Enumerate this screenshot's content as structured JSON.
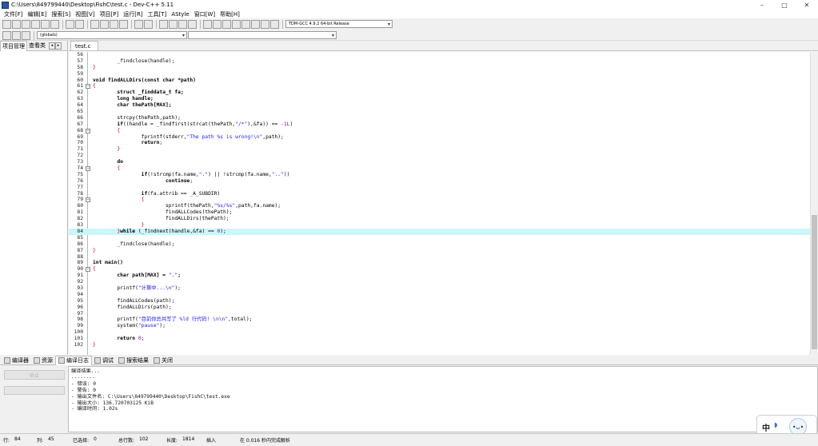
{
  "window": {
    "title": "C:\\Users\\849799440\\Desktop\\FishC\\test.c - Dev-C++ 5.11"
  },
  "menu": [
    {
      "label": "文件[F]"
    },
    {
      "label": "编辑[E]"
    },
    {
      "label": "搜索[S]"
    },
    {
      "label": "视图[V]"
    },
    {
      "label": "项目[P]"
    },
    {
      "label": "运行[R]"
    },
    {
      "label": "工具[T]"
    },
    {
      "label": "AStyle"
    },
    {
      "label": "窗口[W]"
    },
    {
      "label": "帮助[H]"
    }
  ],
  "toolbar": {
    "compiler_select": "TDM-GCC 4.9.2 64-bit Release",
    "scope_select": "(globals)",
    "symbol_select": ""
  },
  "left_panel": {
    "tabs": [
      {
        "label": "项目管理"
      },
      {
        "label": "查看类"
      }
    ]
  },
  "editor": {
    "tab_label": "test.c",
    "lines": [
      {
        "n": "56",
        "fold": "",
        "code": [
          {
            "t": ""
          }
        ]
      },
      {
        "n": "57",
        "fold": "",
        "code": [
          {
            "t": "        _findclose(handle);"
          }
        ]
      },
      {
        "n": "58",
        "fold": "",
        "code": [
          {
            "t": "}",
            "c": "sym"
          }
        ]
      },
      {
        "n": "59",
        "fold": "",
        "code": [
          {
            "t": ""
          }
        ]
      },
      {
        "n": "60",
        "fold": "",
        "code": [
          {
            "t": "void",
            "c": "kw"
          },
          {
            "t": " findALLDirs(",
            "c": "kw"
          },
          {
            "t": "const",
            "c": "kw"
          },
          {
            "t": " char",
            "c": "kw"
          },
          {
            "t": " *path)",
            "c": "kw"
          }
        ]
      },
      {
        "n": "61",
        "fold": "−",
        "code": [
          {
            "t": "{",
            "c": "sym"
          }
        ]
      },
      {
        "n": "62",
        "fold": "",
        "code": [
          {
            "t": "        "
          },
          {
            "t": "struct",
            "c": "kw"
          },
          {
            "t": " _finddata_t fa;",
            "c": "kw"
          }
        ]
      },
      {
        "n": "63",
        "fold": "",
        "code": [
          {
            "t": "        "
          },
          {
            "t": "long",
            "c": "kw"
          },
          {
            "t": " handle;",
            "c": "kw"
          }
        ]
      },
      {
        "n": "64",
        "fold": "",
        "code": [
          {
            "t": "        "
          },
          {
            "t": "char",
            "c": "kw"
          },
          {
            "t": " thePath[MAX];",
            "c": "kw"
          }
        ]
      },
      {
        "n": "65",
        "fold": "",
        "code": [
          {
            "t": ""
          }
        ]
      },
      {
        "n": "66",
        "fold": "",
        "code": [
          {
            "t": "        strcpy(thePath,path);"
          }
        ]
      },
      {
        "n": "67",
        "fold": "",
        "code": [
          {
            "t": "        "
          },
          {
            "t": "if",
            "c": "kw"
          },
          {
            "t": "((handle = _findfirst(strcat(thePath,"
          },
          {
            "t": "\"/*\"",
            "c": "str"
          },
          {
            "t": "),&fa)) == "
          },
          {
            "t": "-1L",
            "c": "num"
          },
          {
            "t": ")"
          }
        ]
      },
      {
        "n": "68",
        "fold": "−",
        "code": [
          {
            "t": "        "
          },
          {
            "t": "{",
            "c": "sym"
          }
        ]
      },
      {
        "n": "69",
        "fold": "",
        "code": [
          {
            "t": "                fprintf(stderr,"
          },
          {
            "t": "\"The path %s is wrong!\\n\"",
            "c": "str"
          },
          {
            "t": ",path);"
          }
        ]
      },
      {
        "n": "70",
        "fold": "",
        "code": [
          {
            "t": "                "
          },
          {
            "t": "return",
            "c": "kw"
          },
          {
            "t": ";"
          }
        ]
      },
      {
        "n": "71",
        "fold": "",
        "code": [
          {
            "t": "        "
          },
          {
            "t": "}",
            "c": "sym"
          }
        ]
      },
      {
        "n": "72",
        "fold": "",
        "code": [
          {
            "t": ""
          }
        ]
      },
      {
        "n": "73",
        "fold": "",
        "code": [
          {
            "t": "        "
          },
          {
            "t": "do",
            "c": "kw"
          }
        ]
      },
      {
        "n": "74",
        "fold": "−",
        "code": [
          {
            "t": "        "
          },
          {
            "t": "{",
            "c": "sym"
          }
        ]
      },
      {
        "n": "75",
        "fold": "",
        "code": [
          {
            "t": "                "
          },
          {
            "t": "if",
            "c": "kw"
          },
          {
            "t": "(!strcmp(fa.name,"
          },
          {
            "t": "\".\"",
            "c": "str"
          },
          {
            "t": ") || !strcmp(fa.name,"
          },
          {
            "t": "\"..\"",
            "c": "str"
          },
          {
            "t": "))"
          }
        ]
      },
      {
        "n": "76",
        "fold": "",
        "code": [
          {
            "t": "                        "
          },
          {
            "t": "continue",
            "c": "kw"
          },
          {
            "t": ";"
          }
        ]
      },
      {
        "n": "77",
        "fold": "",
        "code": [
          {
            "t": ""
          }
        ]
      },
      {
        "n": "78",
        "fold": "",
        "code": [
          {
            "t": "                "
          },
          {
            "t": "if",
            "c": "kw"
          },
          {
            "t": "(fa.attrib == _A_SUBDIR)"
          }
        ]
      },
      {
        "n": "79",
        "fold": "−",
        "code": [
          {
            "t": "                "
          },
          {
            "t": "{",
            "c": "sym"
          }
        ]
      },
      {
        "n": "80",
        "fold": "",
        "code": [
          {
            "t": "                        sprintf(thePath,"
          },
          {
            "t": "\"%s/%s\"",
            "c": "str"
          },
          {
            "t": ",path,fa.name);"
          }
        ]
      },
      {
        "n": "81",
        "fold": "",
        "code": [
          {
            "t": "                        findALLCodes(thePath);"
          }
        ]
      },
      {
        "n": "82",
        "fold": "",
        "code": [
          {
            "t": "                        findALLDirs(thePath);"
          }
        ]
      },
      {
        "n": "83",
        "fold": "",
        "code": [
          {
            "t": "                "
          },
          {
            "t": "}",
            "c": "sym"
          }
        ]
      },
      {
        "n": "84",
        "fold": "",
        "hl": true,
        "code": [
          {
            "t": "        "
          },
          {
            "t": "}",
            "c": "sym"
          },
          {
            "t": "while",
            "c": "kw"
          },
          {
            "t": " (_findnext(handle,&fa) == "
          },
          {
            "t": "0",
            "c": "num"
          },
          {
            "t": ");"
          }
        ]
      },
      {
        "n": "85",
        "fold": "",
        "code": [
          {
            "t": ""
          }
        ]
      },
      {
        "n": "86",
        "fold": "",
        "code": [
          {
            "t": "        _findclose(handle);"
          }
        ]
      },
      {
        "n": "87",
        "fold": "",
        "code": [
          {
            "t": "}",
            "c": "sym"
          }
        ]
      },
      {
        "n": "88",
        "fold": "",
        "code": [
          {
            "t": ""
          }
        ]
      },
      {
        "n": "89",
        "fold": "",
        "code": [
          {
            "t": "int",
            "c": "kw"
          },
          {
            "t": " main()",
            "c": "kw"
          }
        ]
      },
      {
        "n": "90",
        "fold": "−",
        "code": [
          {
            "t": "{",
            "c": "sym"
          }
        ]
      },
      {
        "n": "91",
        "fold": "",
        "code": [
          {
            "t": "        "
          },
          {
            "t": "char",
            "c": "kw"
          },
          {
            "t": " path[MAX] = ",
            "c": "kw"
          },
          {
            "t": "\".\"",
            "c": "str"
          },
          {
            "t": ";",
            "c": "kw"
          }
        ]
      },
      {
        "n": "92",
        "fold": "",
        "code": [
          {
            "t": ""
          }
        ]
      },
      {
        "n": "93",
        "fold": "",
        "code": [
          {
            "t": "        printf("
          },
          {
            "t": "\"计算中...\\n\"",
            "c": "str"
          },
          {
            "t": ");"
          }
        ]
      },
      {
        "n": "94",
        "fold": "",
        "code": [
          {
            "t": ""
          }
        ]
      },
      {
        "n": "95",
        "fold": "",
        "code": [
          {
            "t": "        findALLCodes(path);"
          }
        ]
      },
      {
        "n": "96",
        "fold": "",
        "code": [
          {
            "t": "        findALLDirs(path);"
          }
        ]
      },
      {
        "n": "97",
        "fold": "",
        "code": [
          {
            "t": ""
          }
        ]
      },
      {
        "n": "98",
        "fold": "",
        "code": [
          {
            "t": "        printf("
          },
          {
            "t": "\"目前你总共写了 %ld 行代码! \\n\\n\"",
            "c": "str"
          },
          {
            "t": ",total);"
          }
        ]
      },
      {
        "n": "99",
        "fold": "",
        "code": [
          {
            "t": "        system("
          },
          {
            "t": "\"pause\"",
            "c": "str"
          },
          {
            "t": ");"
          }
        ]
      },
      {
        "n": "100",
        "fold": "",
        "code": [
          {
            "t": ""
          }
        ]
      },
      {
        "n": "101",
        "fold": "",
        "code": [
          {
            "t": "        "
          },
          {
            "t": "return",
            "c": "kw"
          },
          {
            "t": " "
          },
          {
            "t": "0",
            "c": "num"
          },
          {
            "t": ";"
          }
        ]
      },
      {
        "n": "102",
        "fold": "",
        "code": [
          {
            "t": "}",
            "c": "sym"
          }
        ]
      }
    ]
  },
  "bottom_tabs": [
    {
      "label": "编译器",
      "name": "tab-compiler"
    },
    {
      "label": "资源",
      "name": "tab-resources"
    },
    {
      "label": "编译日志",
      "name": "tab-compile-log",
      "active": true
    },
    {
      "label": "调试",
      "name": "tab-debug"
    },
    {
      "label": "搜索结果",
      "name": "tab-search-results"
    },
    {
      "label": "关闭",
      "name": "tab-close"
    }
  ],
  "compile_panel": {
    "abort_button": "中止",
    "log": [
      "编译结果...",
      "--------",
      "- 错误: 0",
      "- 警告: 0",
      "- 输出文件名: C:\\Users\\849799440\\Desktop\\FishC\\test.exe",
      "- 输出大小: 136.720703125 KiB",
      "- 编译时间: 1.02s"
    ]
  },
  "ime": {
    "text": "中"
  },
  "status": {
    "row_label": "行:",
    "row_value": "84",
    "col_label": "列:",
    "col_value": "45",
    "selected_label": "已选择:",
    "selected_value": "0",
    "total_label": "总行数:",
    "total_value": "102",
    "length_label": "长度:",
    "length_value": "1814",
    "mode": "插入",
    "parse_msg": "在 0.016 秒内完成解析"
  }
}
